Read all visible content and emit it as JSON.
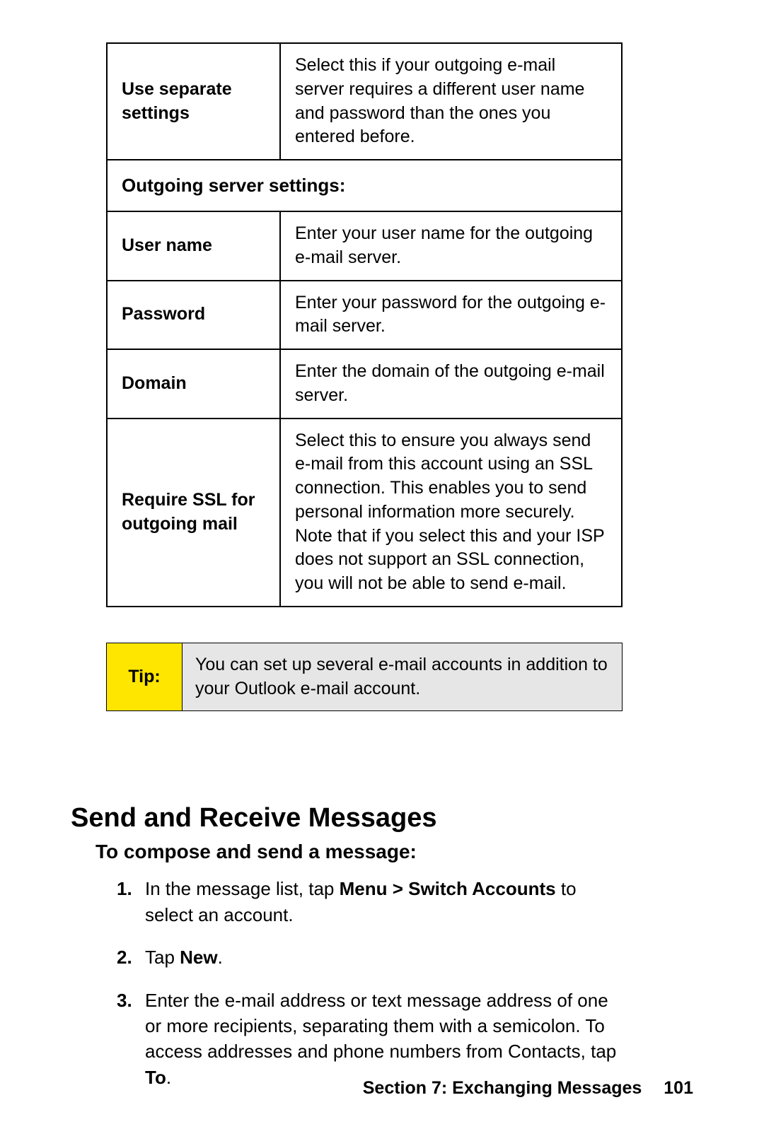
{
  "table": {
    "row1": {
      "label": "Use separate settings",
      "desc": "Select this if your outgoing e-mail server requires a different user name and password than the ones you entered before."
    },
    "sectionHeader": "Outgoing server settings:",
    "row2": {
      "label": "User name",
      "desc": "Enter your user name for the outgoing e-mail server."
    },
    "row3": {
      "label": "Password",
      "desc": "Enter your password for the outgoing e-mail server."
    },
    "row4": {
      "label": "Domain",
      "desc": "Enter the domain of the outgoing e-mail server."
    },
    "row5": {
      "label": "Require SSL for outgoing mail",
      "desc": "Select this to ensure you always send e-mail from this account using an SSL connection. This enables you to send personal information more securely. Note that if you select this and your ISP does not support an SSL connection, you will not be able to send e-mail."
    }
  },
  "tip": {
    "label": "Tip:",
    "body": "You can set up several e-mail accounts in addition to your Outlook e-mail account."
  },
  "heading": "Send and Receive Messages",
  "subheading": "To compose and send a message:",
  "steps": {
    "s1": {
      "num": "1.",
      "pre": "In the message list, tap ",
      "bold": "Menu > Switch Accounts",
      "post": " to select an account."
    },
    "s2": {
      "num": "2.",
      "pre": "Tap ",
      "bold": "New",
      "post": "."
    },
    "s3": {
      "num": "3.",
      "pre": "Enter the e-mail address or text message address of one or more recipients, separating them with a semicolon. To access addresses and phone numbers from Contacts, tap ",
      "bold": "To",
      "post": "."
    }
  },
  "footer": {
    "section": "Section 7: Exchanging Messages",
    "page": "101"
  }
}
